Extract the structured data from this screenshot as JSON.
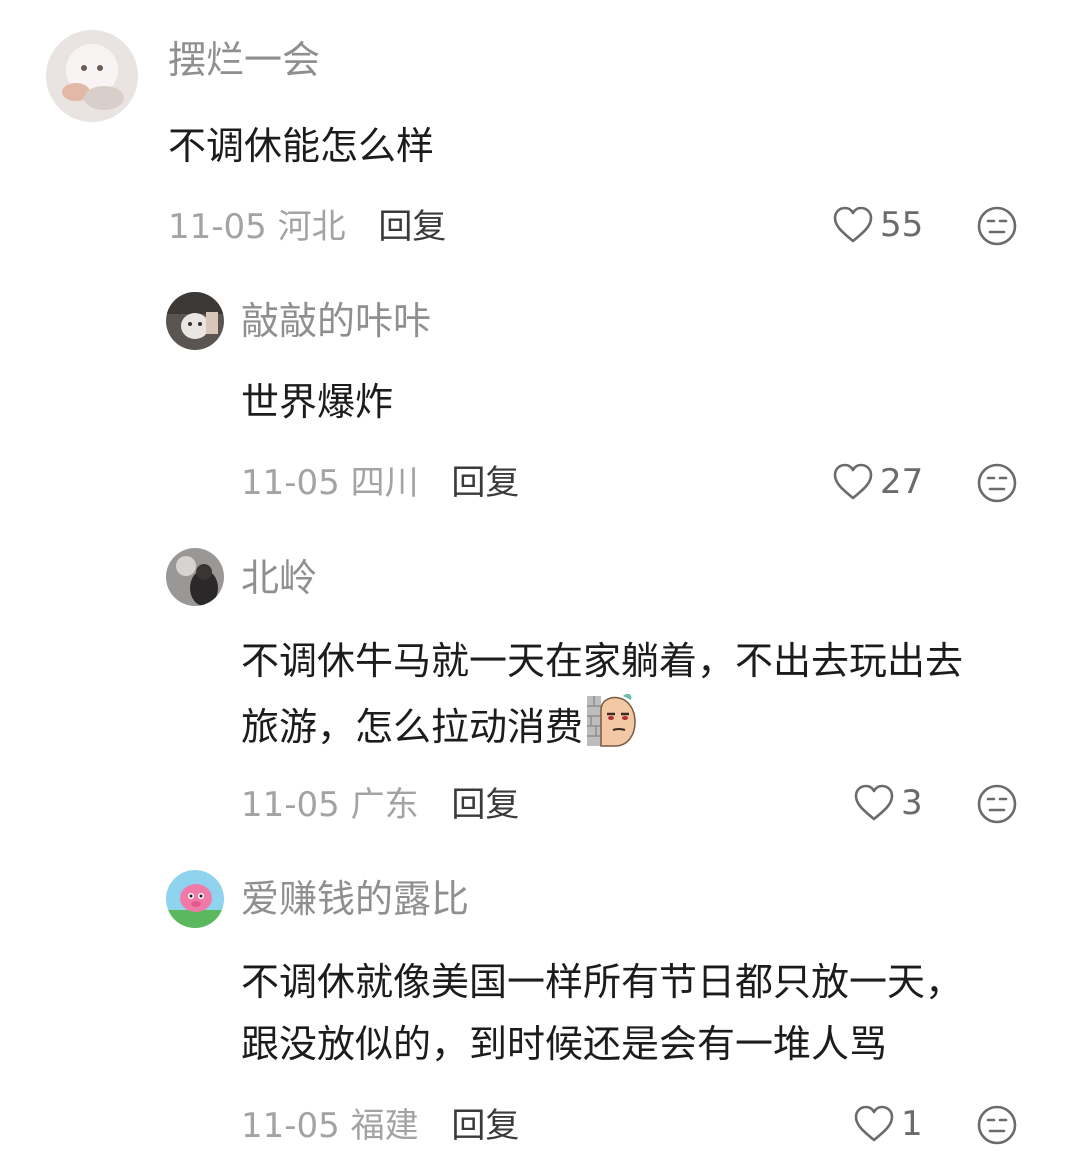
{
  "comments": [
    {
      "username": "摆烂一会",
      "text_lines": [
        "不调休能怎么样"
      ],
      "date": "11-05",
      "location": "河北",
      "reply_label": "回复",
      "likes": "55"
    },
    {
      "username": "敲敲的咔咔",
      "text_lines": [
        "世界爆炸"
      ],
      "date": "11-05",
      "location": "四川",
      "reply_label": "回复",
      "likes": "27"
    },
    {
      "username": "北岭",
      "text_lines": [
        "不调休牛马就一天在家躺着，不出去玩出去",
        "旅游，怎么拉动消费"
      ],
      "date": "11-05",
      "location": "广东",
      "reply_label": "回复",
      "likes": "3"
    },
    {
      "username": "爱赚钱的露比",
      "text_lines": [
        "不调休就像美国一样所有节日都只放一天，",
        "跟没放似的，到时候还是会有一堆人骂"
      ],
      "date": "11-05",
      "location": "福建",
      "reply_label": "回复",
      "likes": "1"
    }
  ],
  "icons": {
    "like": "heart-outline-icon",
    "dislike": "meh-face-icon",
    "inline_emoji": "peeking-wall-emoji"
  },
  "colors": {
    "username": "#8f8f8f",
    "content": "#1c1c1c",
    "meta": "#a3a3a3",
    "reply": "#3a3a3a"
  }
}
